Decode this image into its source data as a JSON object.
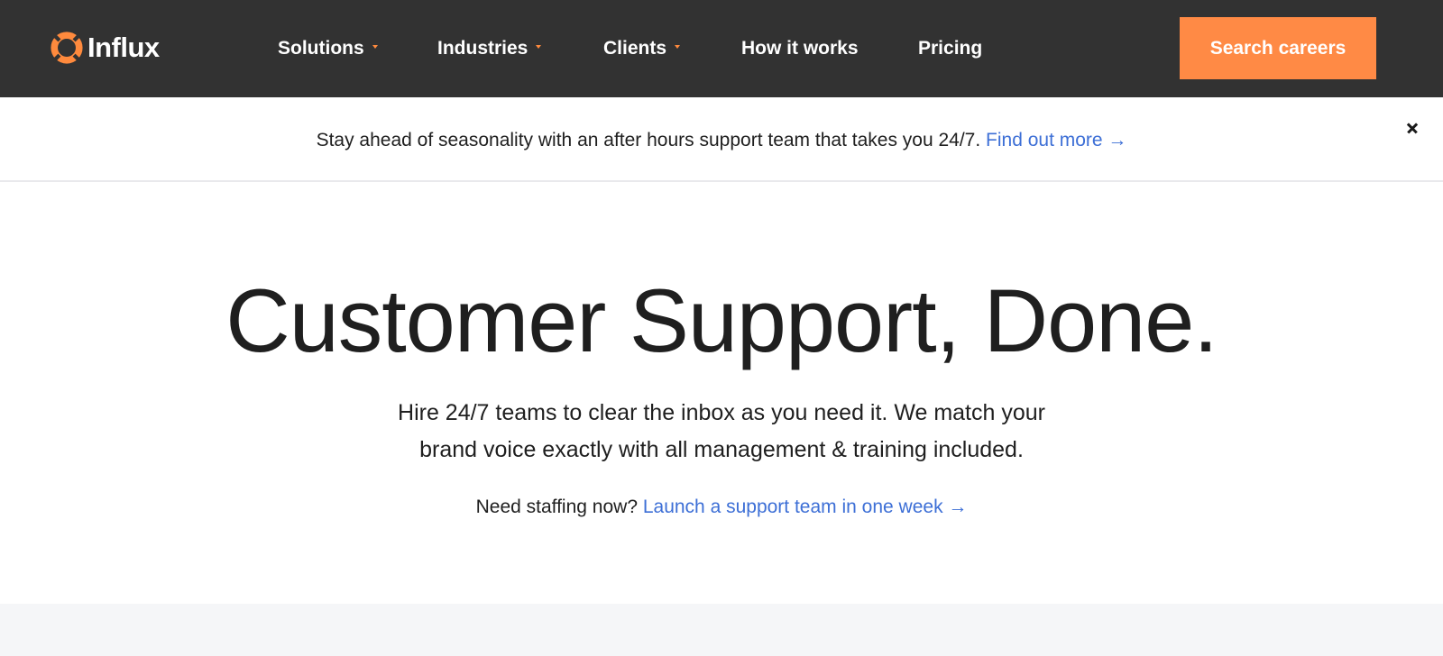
{
  "header": {
    "logo_text": "Influx",
    "logo_icon": "lifebuoy-icon",
    "nav": {
      "solutions": "Solutions",
      "industries": "Industries",
      "clients": "Clients",
      "how_it_works": "How it works",
      "pricing": "Pricing"
    },
    "cta_label": "Search careers"
  },
  "announcement": {
    "text": "Stay ahead of seasonality with an after hours support team that takes you 24/7.",
    "link_label": "Find out more →"
  },
  "hero": {
    "title": "Customer Support, Done.",
    "subtitle_line1": "Hire 24/7 teams to clear the inbox as you need it. We match your",
    "subtitle_line2": "brand voice exactly with all management & training included.",
    "cta_prefix": "Need staffing now?",
    "cta_link": "Launch a support team in one week →"
  },
  "colors": {
    "nav_bg": "#323232",
    "accent": "#ff8a45",
    "link": "#3d6fd6",
    "text": "#1f1f1f",
    "lower_band": "#f5f6f8"
  }
}
